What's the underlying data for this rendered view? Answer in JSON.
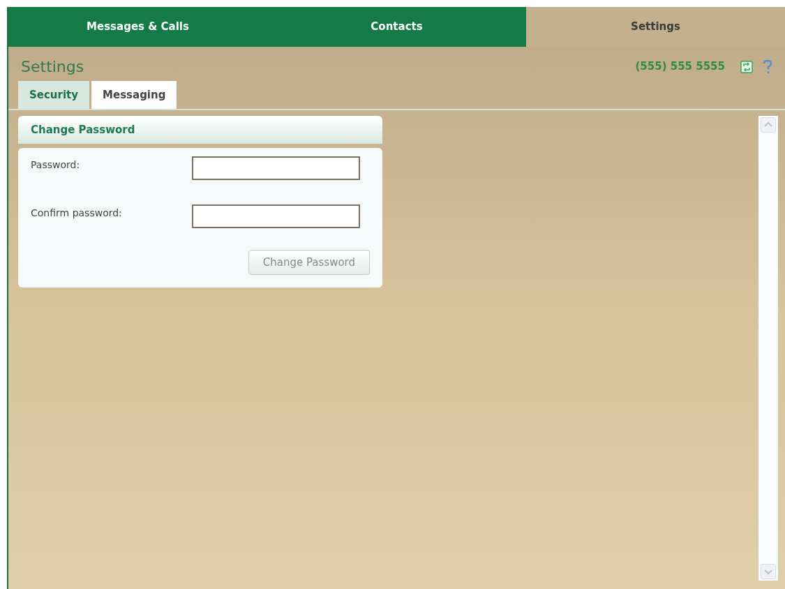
{
  "nav_tabs": [
    {
      "label": "Messages & Calls",
      "selected": false
    },
    {
      "label": "Contacts",
      "selected": false
    },
    {
      "label": "Settings",
      "selected": true
    }
  ],
  "page_title": "Settings",
  "phone_number": "(555) 555 5555",
  "sub_tabs": [
    {
      "label": "Security",
      "selected": true
    },
    {
      "label": "Messaging",
      "selected": false
    }
  ],
  "panel": {
    "title": "Change Password",
    "fields": [
      {
        "label": "Password:"
      },
      {
        "label": "Confirm password:"
      }
    ],
    "button": {
      "label": "Change Password",
      "disabled": true
    }
  }
}
